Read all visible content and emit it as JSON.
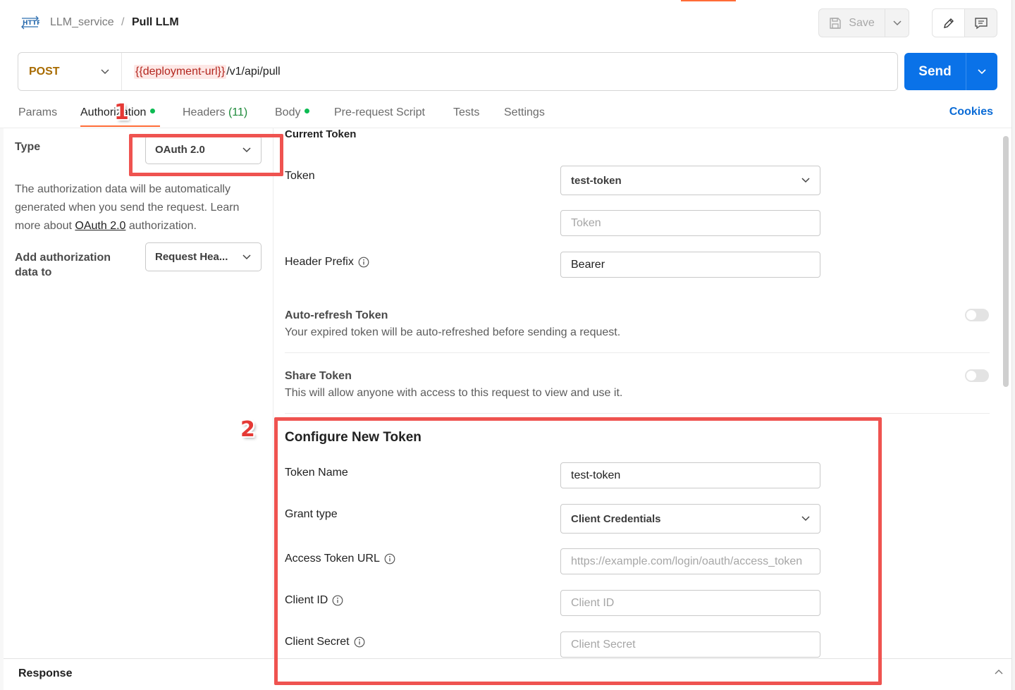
{
  "header": {
    "breadcrumb_parent": "LLM_service",
    "breadcrumb_separator": "/",
    "breadcrumb_current": "Pull LLM",
    "save_label": "Save"
  },
  "request": {
    "method": "POST",
    "url_variable": "{{deployment-url}}",
    "url_path": "/v1/api/pull",
    "send_label": "Send"
  },
  "tabs": [
    {
      "label": "Params"
    },
    {
      "label": "Authorization",
      "active": true,
      "dot": true
    },
    {
      "label": "Headers",
      "count": "(11)"
    },
    {
      "label": "Body",
      "dot": true
    },
    {
      "label": "Pre-request Script"
    },
    {
      "label": "Tests"
    },
    {
      "label": "Settings"
    }
  ],
  "cookies_label": "Cookies",
  "auth": {
    "type_label": "Type",
    "type_value": "OAuth 2.0",
    "description_before": "The authorization data will be automatically generated when you send the request. Learn more about ",
    "description_link": "OAuth 2.0",
    "description_after": " authorization.",
    "add_to_label": "Add authorization data to",
    "add_to_value": "Request Hea..."
  },
  "current_token": {
    "title": "Current Token",
    "token_label": "Token",
    "token_selected": "test-token",
    "token_placeholder": "Token",
    "header_prefix_label": "Header Prefix",
    "header_prefix_value": "Bearer",
    "auto_refresh_title": "Auto-refresh Token",
    "auto_refresh_desc": "Your expired token will be auto-refreshed before sending a request.",
    "auto_refresh_on": false,
    "share_title": "Share Token",
    "share_desc": "This will allow anyone with access to this request to view and use it.",
    "share_on": false
  },
  "new_token": {
    "title": "Configure New Token",
    "token_name_label": "Token Name",
    "token_name_value": "test-token",
    "grant_type_label": "Grant type",
    "grant_type_value": "Client Credentials",
    "access_token_url_label": "Access Token URL",
    "access_token_url_placeholder": "https://example.com/login/oauth/access_token",
    "client_id_label": "Client ID",
    "client_id_placeholder": "Client ID",
    "client_secret_label": "Client Secret",
    "client_secret_placeholder": "Client Secret"
  },
  "response_label": "Response",
  "annotations": {
    "one": "1",
    "two": "2",
    "color": "#ef5350"
  },
  "colors": {
    "accent": "#ff6c37",
    "send": "#0a72e8",
    "method": "#a86b00",
    "variable": "#b3261e",
    "link": "#0a6bd6",
    "dot": "#0cbb52"
  }
}
